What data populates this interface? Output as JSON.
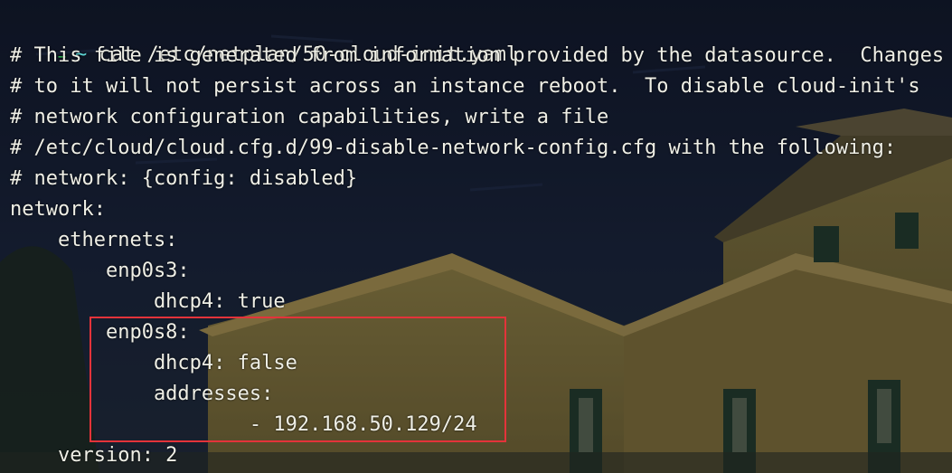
{
  "colors": {
    "prompt_arrow": "#37d158",
    "prompt_tilde": "#5fd7d7",
    "text": "#efefe6",
    "highlight_border": "#e4333a"
  },
  "prompt": {
    "arrow_icon": "right-arrow",
    "arrow": "→",
    "directory": "~",
    "command": "cat /etc/netplan/50-cloud-init.yaml"
  },
  "output_lines": [
    "# This file is generated from information provided by the datasource.  Changes",
    "# to it will not persist across an instance reboot.  To disable cloud-init's",
    "# network configuration capabilities, write a file",
    "# /etc/cloud/cloud.cfg.d/99-disable-network-config.cfg with the following:",
    "# network: {config: disabled}",
    "network:",
    "    ethernets:",
    "        enp0s3:",
    "            dhcp4: true",
    "        enp0s8:",
    "            dhcp4: false",
    "            addresses:",
    "                    - 192.168.50.129/24",
    "    version: 2"
  ]
}
